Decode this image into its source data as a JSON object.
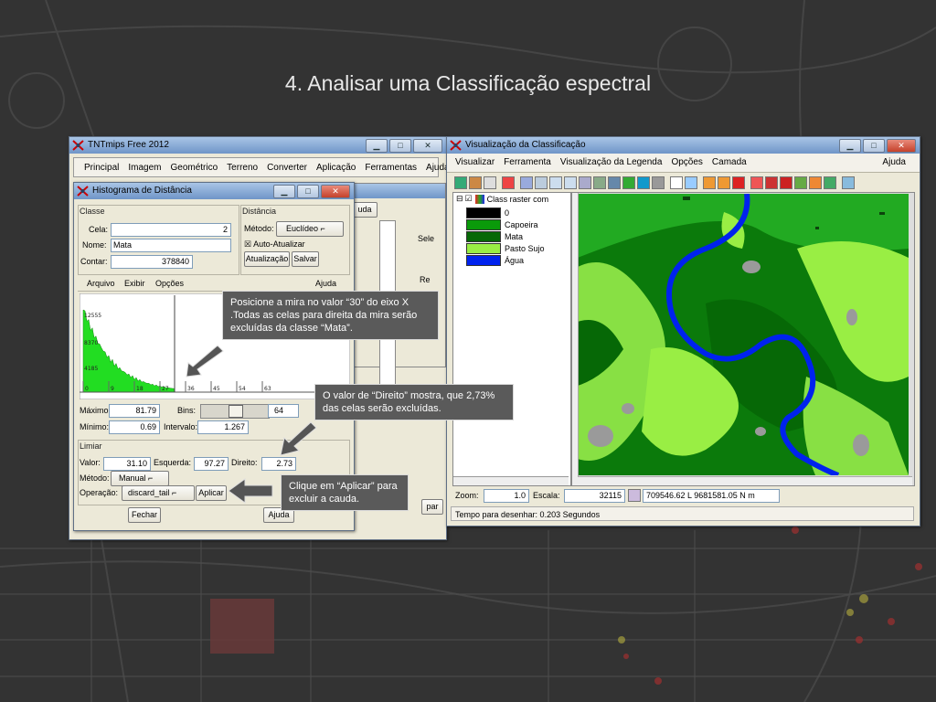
{
  "slide": {
    "title": "4. Analisar uma Classificação espectral"
  },
  "tntmips": {
    "title": "TNTmips Free 2012",
    "menu": [
      "Principal",
      "Imagem",
      "Geométrico",
      "Terreno",
      "Converter",
      "Aplicação",
      "Ferramentas",
      "Ajuda"
    ],
    "partial_labels": {
      "ajuda": "uda",
      "sele": "Sele",
      "re": "Re",
      "par": "par"
    }
  },
  "histogram": {
    "title": "Histograma de Distância",
    "classe": {
      "group": "Classe",
      "cela_label": "Cela:",
      "cela": "2",
      "nome_label": "Nome:",
      "nome": "Mata",
      "contar_label": "Contar:",
      "contar": "378840"
    },
    "distancia": {
      "group": "Distância",
      "metodo_label": "Método:",
      "metodo": "Euclídeo",
      "auto": "Auto-Atualizar",
      "atualizacao": "Atualização",
      "salvar": "Salvar"
    },
    "menu": [
      "Arquivo",
      "Exibir",
      "Opções"
    ],
    "ajuda": "Ajuda",
    "y_labels": [
      "12555",
      "8370",
      "4185"
    ],
    "x_labels": [
      "0",
      "9",
      "18",
      "27",
      "36",
      "45",
      "54",
      "63"
    ],
    "maximo_label": "Máximo:",
    "maximo": "81.79",
    "minimo_label": "Mínimo:",
    "minimo": "0.69",
    "bins_label": "Bins:",
    "bins": "64",
    "intervalo_label": "Intervalo:",
    "intervalo": "1.267",
    "limiar": {
      "group": "Limiar",
      "valor_label": "Valor:",
      "valor": "31.10",
      "esquerda_label": "Esquerda:",
      "esquerda": "97.27",
      "direito_label": "Direito:",
      "direito": "2.73",
      "metodo_label": "Método:",
      "metodo": "Manual",
      "operacao_label": "Operação:",
      "operacao": "discard_tail",
      "aplicar": "Aplicar"
    },
    "fechar": "Fechar",
    "ajuda_bottom": "Ajuda",
    "fill_color": "#22dd22"
  },
  "viewer": {
    "title": "Visualização da Classificação",
    "menu": [
      "Visualizar",
      "Ferramenta",
      "Visualização da Legenda",
      "Opções",
      "Camada"
    ],
    "ajuda": "Ajuda",
    "layer": "Class raster com",
    "legend": [
      {
        "label": "0",
        "color": "#000000"
      },
      {
        "label": "Capoeira",
        "color": "#0a9a0a"
      },
      {
        "label": "Mata",
        "color": "#066806"
      },
      {
        "label": "Pasto Sujo",
        "color": "#99ee44"
      },
      {
        "label": "Água",
        "color": "#0022ee"
      }
    ],
    "zoom_label": "Zoom:",
    "zoom": "1.0",
    "escala_label": "Escala:",
    "escala": "32115",
    "coords": "709546.62 L  9681581.05 N m",
    "status": "Tempo para desenhar: 0.203 Segundos"
  },
  "callouts": [
    "Posicione a mira no valor “30” do eixo X .Todas as celas para direita da mira serão excluídas da classe “Mata”.",
    "O valor de “Direito” mostra, que 2,73% das celas serão excluídas.",
    "Clique em “Aplicar” para excluir a cauda."
  ]
}
